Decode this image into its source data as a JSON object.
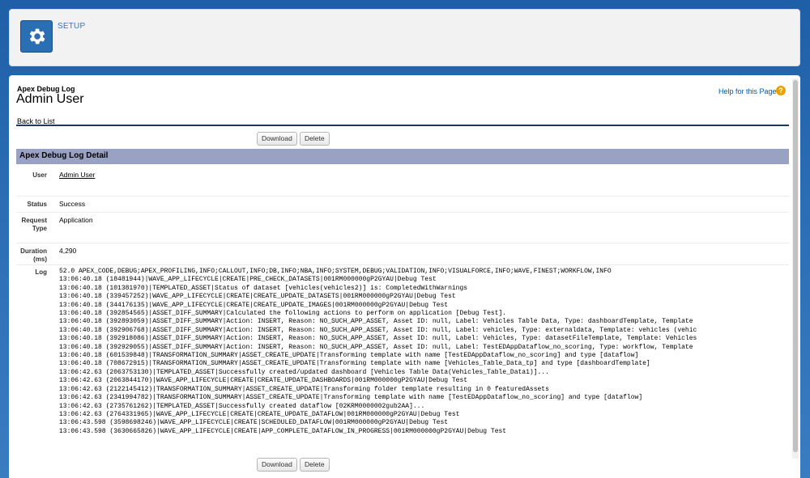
{
  "header": {
    "title": "SETUP",
    "icon": "gear-icon"
  },
  "page": {
    "type_label": "Apex Debug Log",
    "title": "Admin User",
    "help_link": "Help for this Page",
    "help_icon": "?",
    "back_link": "Back to List"
  },
  "buttons": {
    "download": "Download",
    "delete": "Delete"
  },
  "section": {
    "title": "Apex Debug Log Detail"
  },
  "fields": {
    "user": {
      "label": "User",
      "value": "Admin User"
    },
    "status": {
      "label": "Status",
      "value": "Success"
    },
    "request_type": {
      "label": "Request Type",
      "value": "Application"
    },
    "duration": {
      "label": "Duration (ms)",
      "value": "4,290"
    },
    "log": {
      "label": "Log"
    }
  },
  "log_text": "52.0 APEX_CODE,DEBUG;APEX_PROFILING,INFO;CALLOUT,INFO;DB,INFO;NBA,INFO;SYSTEM,DEBUG;VALIDATION,INFO;VISUALFORCE,INFO;WAVE,FINEST;WORKFLOW,INFO\n13:06:40.18 (18481944)|WAVE_APP_LIFECYCLE|CREATE|PRE_CHECK_DATASETS|001RM000000gP2GYAU|Debug Test\n13:06:40.18 (101381970)|TEMPLATED_ASSET|Status of dataset [vehicles(vehicles2)] is: CompletedWithWarnings\n13:06:40.18 (339457252)|WAVE_APP_LIFECYCLE|CREATE|CREATE_UPDATE_DATASETS|001RM000000gP2GYAU|Debug Test\n13:06:40.18 (344176135)|WAVE_APP_LIFECYCLE|CREATE|CREATE_UPDATE_IMAGES|001RM000000gP2GYAU|Debug Test\n13:06:40.18 (392854565)|ASSET_DIFF_SUMMARY|Calculated the following actions to perform on application [Debug Test].\n13:06:40.18 (392893059)|ASSET_DIFF_SUMMARY|Action: INSERT, Reason: NO_SUCH_APP_ASSET, Asset ID: null, Label: Vehicles Table Data, Type: dashboardTemplate, Template\n13:06:40.18 (392906768)|ASSET_DIFF_SUMMARY|Action: INSERT, Reason: NO_SUCH_APP_ASSET, Asset ID: null, Label: vehicles, Type: externaldata, Template: vehicles (vehic\n13:06:40.18 (392918086)|ASSET_DIFF_SUMMARY|Action: INSERT, Reason: NO_SUCH_APP_ASSET, Asset ID: null, Label: Vehicles, Type: datasetFileTemplate, Template: Vehicles\n13:06:40.18 (392929055)|ASSET_DIFF_SUMMARY|Action: INSERT, Reason: NO_SUCH_APP_ASSET, Asset ID: null, Label: TestEDAppDataflow_no_scoring, Type: workflow, Template\n13:06:40.18 (601539848)|TRANSFORMATION_SUMMARY|ASSET_CREATE_UPDATE|Transforming template with name [TestEDAppDataflow_no_scoring] and type [dataflow]\n13:06:40.18 (708672915)|TRANSFORMATION_SUMMARY|ASSET_CREATE_UPDATE|Transforming template with name [Vehicles_Table_Data_tp] and type [dashboardTemplate]\n13:06:42.63 (2063753130)|TEMPLATED_ASSET|Successfully created/updated dashboard [Vehicles Table Data(Vehicles_Table_Data1)]...\n13:06:42.63 (2063844170)|WAVE_APP_LIFECYCLE|CREATE|CREATE_UPDATE_DASHBOARDS|001RM000000gP2GYAU|Debug Test\n13:06:42.63 (2122145412)|TRANSFORMATION_SUMMARY|ASSET_CREATE_UPDATE|Transforming folder template resulting in 0 featuredAssets\n13:06:42.63 (2341994782)|TRANSFORMATION_SUMMARY|ASSET_CREATE_UPDATE|Transforming template with name [TestEDAppDataflow_no_scoring] and type [dataflow]\n13:06:42.63 (2735761262)|TEMPLATED_ASSET|Successfully created dataflow [02KRM0000002gub2AA]...\n13:06:42.63 (2764331965)|WAVE_APP_LIFECYCLE|CREATE|CREATE_UPDATE_DATAFLOW|001RM000000gP2GYAU|Debug Test\n13:06:43.598 (3598698246)|WAVE_APP_LIFECYCLE|CREATE|SCHEDULED_DATAFLOW|001RM000000gP2GYAU|Debug Test\n13:06:43.598 (3630665826)|WAVE_APP_LIFECYCLE|CREATE|APP_COMPLETE_DATAFLOW_IN_PROGRESS|001RM000000gP2GYAU|Debug Test"
}
